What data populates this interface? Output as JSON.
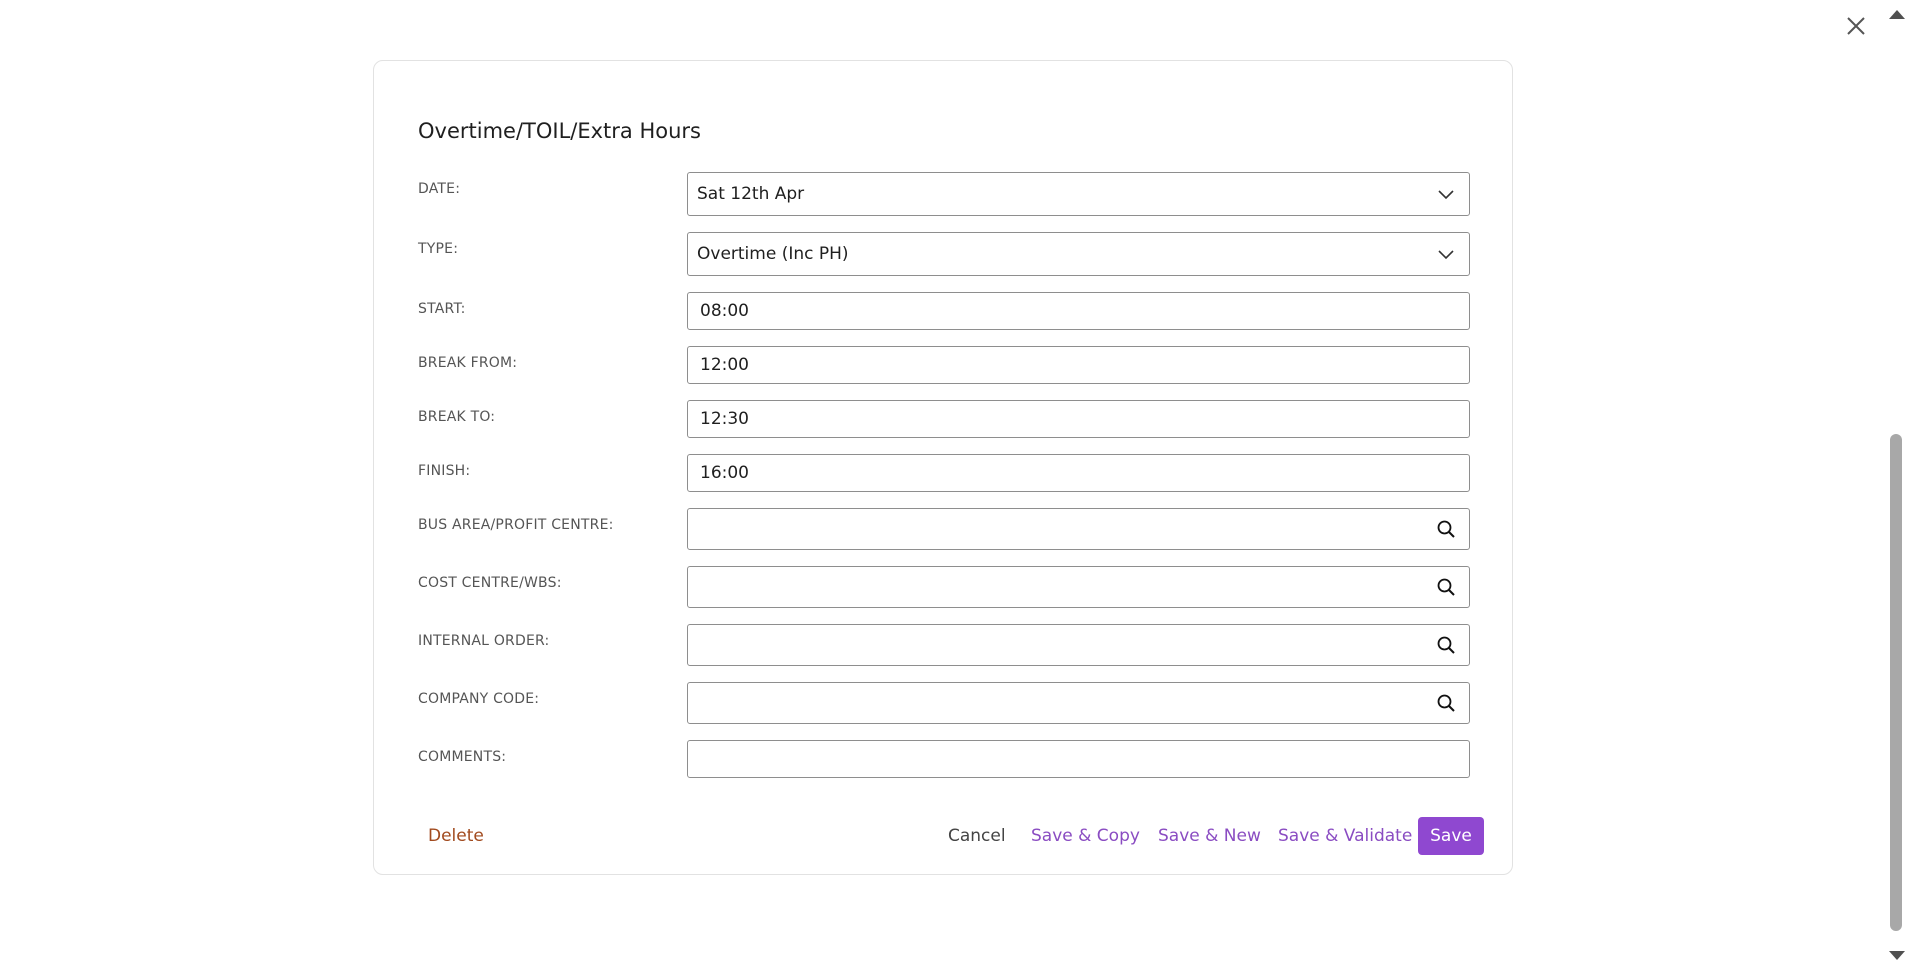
{
  "dialog": {
    "title": "Overtime/TOIL/Extra Hours",
    "close_icon": "close-icon"
  },
  "fields": {
    "date": {
      "label": "DATE:",
      "value": "Sat 12th Apr"
    },
    "type": {
      "label": "TYPE:",
      "value": "Overtime (Inc PH)"
    },
    "start": {
      "label": "START:",
      "value": "08:00"
    },
    "break_from": {
      "label": "BREAK FROM:",
      "value": "12:00"
    },
    "break_to": {
      "label": "BREAK TO:",
      "value": "12:30"
    },
    "finish": {
      "label": "FINISH:",
      "value": "16:00"
    },
    "bus_area": {
      "label": "BUS AREA/PROFIT CENTRE:",
      "value": ""
    },
    "cost_centre": {
      "label": "COST CENTRE/WBS:",
      "value": ""
    },
    "internal_order": {
      "label": "INTERNAL ORDER:",
      "value": ""
    },
    "company_code": {
      "label": "COMPANY CODE:",
      "value": ""
    },
    "comments": {
      "label": "COMMENTS:",
      "value": ""
    }
  },
  "actions": {
    "delete": "Delete",
    "cancel": "Cancel",
    "save_copy": "Save & Copy",
    "save_new": "Save & New",
    "save_validate": "Save & Validate",
    "save": "Save"
  },
  "colors": {
    "accent": "#8f48d0",
    "link": "#8a4cc2",
    "danger": "#a14a1e"
  }
}
